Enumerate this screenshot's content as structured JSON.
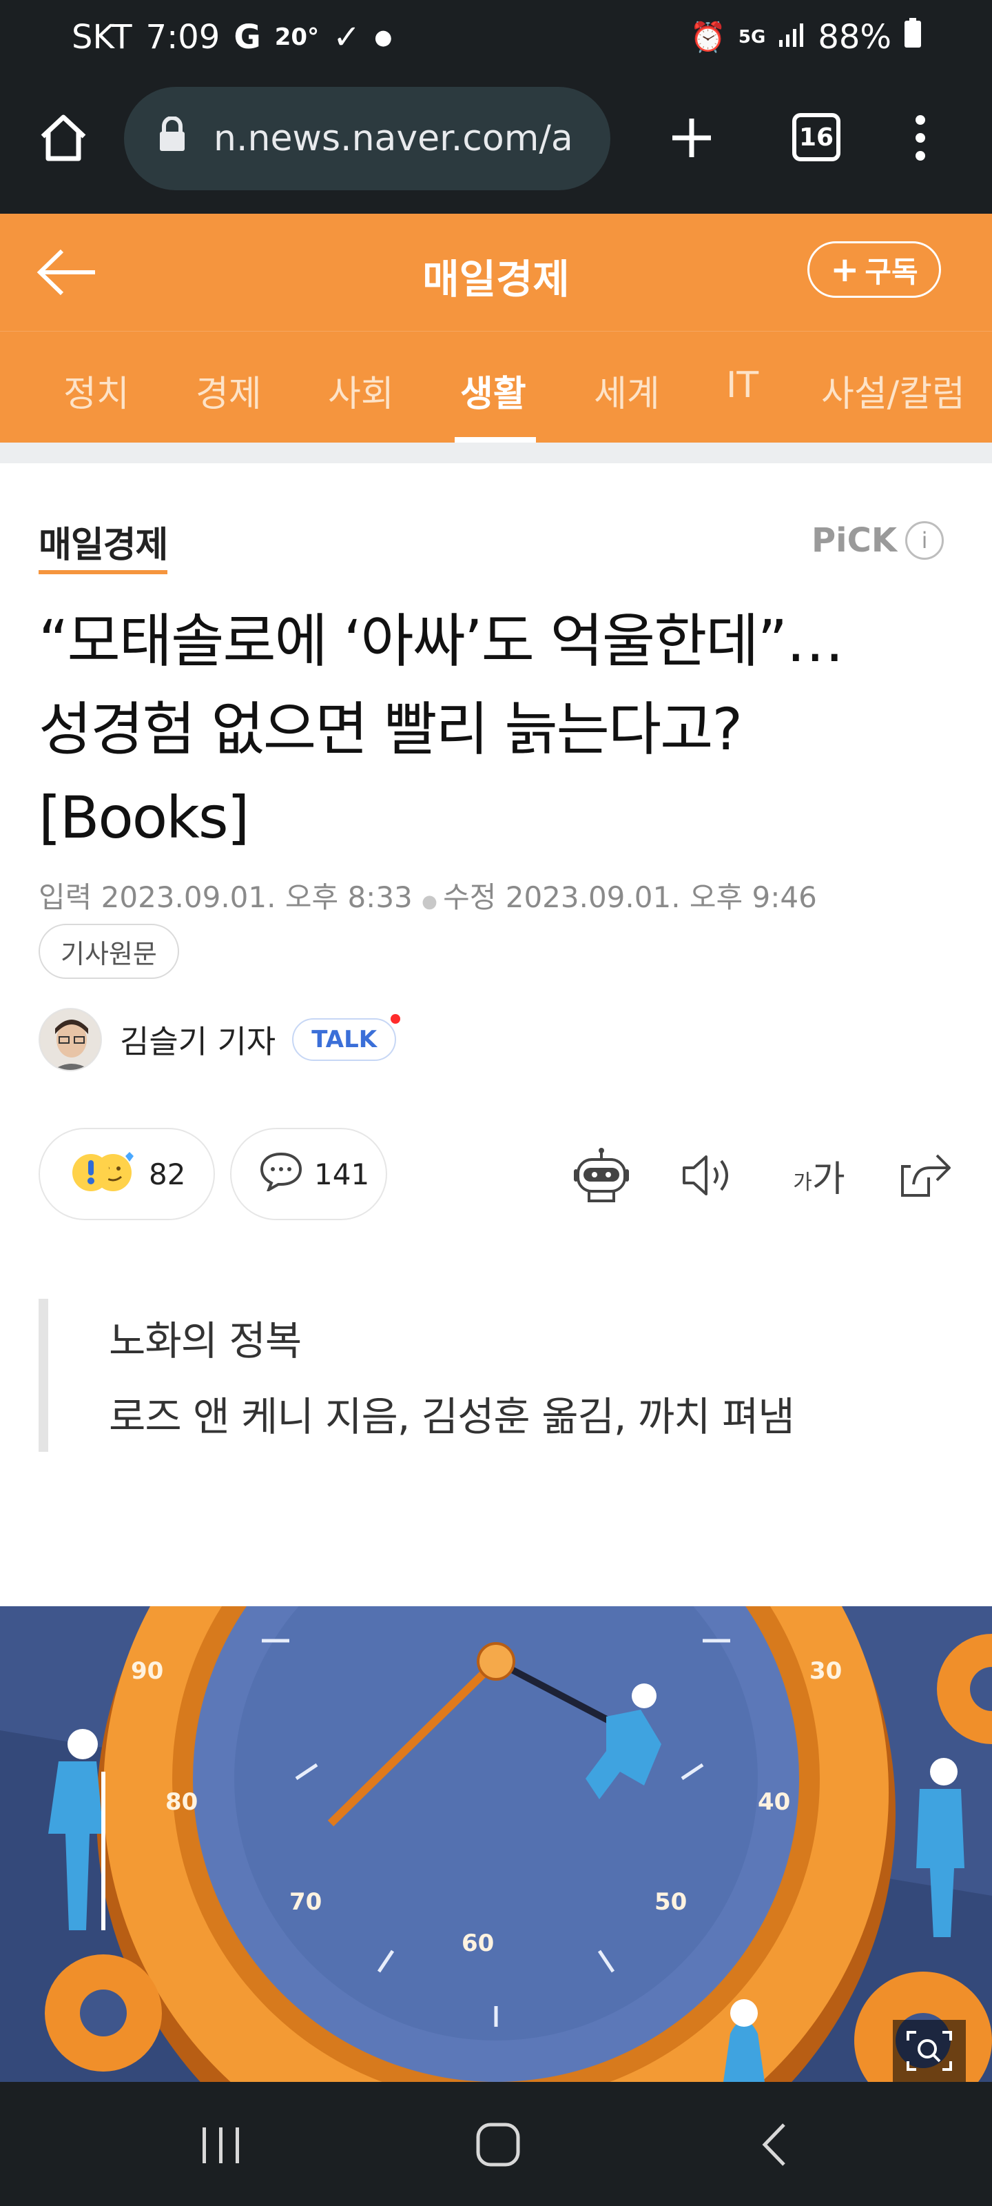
{
  "status_bar": {
    "carrier": "SKT",
    "time": "7:09",
    "temperature": "20°",
    "network": "5G",
    "battery": "88%"
  },
  "browser": {
    "url": "n.news.naver.com/a",
    "tab_count": "16"
  },
  "header": {
    "title": "매일경제",
    "subscribe_label": "구독"
  },
  "nav": {
    "tabs": [
      "정치",
      "경제",
      "사회",
      "생활",
      "세계",
      "IT",
      "사설/칼럼"
    ],
    "active": "생활"
  },
  "article": {
    "press": "매일경제",
    "pick_label": "PiCK",
    "headline_lines": [
      "“모태솔로에 ‘아싸’도 억울한데”…",
      "성경험 없으면 빨리 늙는다고?",
      "[Books]"
    ],
    "date_published_label": "입력",
    "date_published": "2023.09.01. 오후 8:33",
    "date_modified_label": "수정",
    "date_modified": "2023.09.01. 오후 9:46",
    "original_button": "기사원문",
    "reporter": "김슬기 기자",
    "talk_label": "TALK",
    "reaction_count": "82",
    "comment_count": "141",
    "font_size_label_small": "가",
    "font_size_label_large": "가",
    "quote_lines": [
      "노화의 정복",
      "로즈 앤 케니 지음, 김성훈 옮김, 까치 펴냄"
    ]
  },
  "illustration": {
    "dial_labels": [
      "90",
      "80",
      "70",
      "60",
      "50",
      "40",
      "30"
    ]
  },
  "colors": {
    "brand_orange": "#f5953e",
    "dark_bar": "#1b1f22",
    "talk_blue": "#3b6fd8"
  }
}
